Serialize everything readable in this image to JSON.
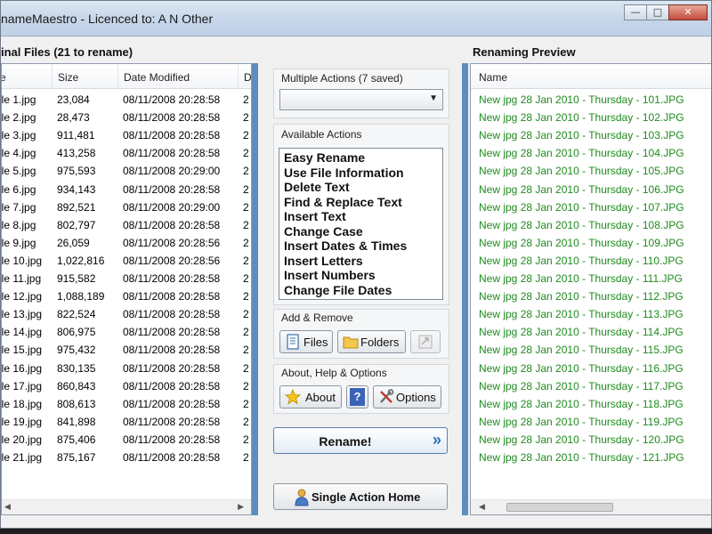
{
  "window": {
    "title": "nameMaestro - Licenced to: A N Other",
    "controls": [
      "—",
      "□",
      "✕"
    ]
  },
  "original_files": {
    "title": "inal Files (21 to rename)",
    "columns": {
      "name": "e",
      "size": "Size",
      "date": "Date Modified",
      "extra": "D"
    },
    "rows": [
      {
        "name": "ile 1.jpg",
        "size": "23,084",
        "date": "08/11/2008 20:28:58",
        "extra": "2"
      },
      {
        "name": "ile 2.jpg",
        "size": "28,473",
        "date": "08/11/2008 20:28:58",
        "extra": "2"
      },
      {
        "name": "ile 3.jpg",
        "size": "911,481",
        "date": "08/11/2008 20:28:58",
        "extra": "2"
      },
      {
        "name": "ile 4.jpg",
        "size": "413,258",
        "date": "08/11/2008 20:28:58",
        "extra": "2"
      },
      {
        "name": "ile 5.jpg",
        "size": "975,593",
        "date": "08/11/2008 20:29:00",
        "extra": "2"
      },
      {
        "name": "ile 6.jpg",
        "size": "934,143",
        "date": "08/11/2008 20:28:58",
        "extra": "2"
      },
      {
        "name": "ile 7.jpg",
        "size": "892,521",
        "date": "08/11/2008 20:29:00",
        "extra": "2"
      },
      {
        "name": "ile 8.jpg",
        "size": "802,797",
        "date": "08/11/2008 20:28:58",
        "extra": "2"
      },
      {
        "name": "ile 9.jpg",
        "size": "26,059",
        "date": "08/11/2008 20:28:56",
        "extra": "2"
      },
      {
        "name": "ile 10.jpg",
        "size": "1,022,816",
        "date": "08/11/2008 20:28:56",
        "extra": "2"
      },
      {
        "name": "ile 11.jpg",
        "size": "915,582",
        "date": "08/11/2008 20:28:58",
        "extra": "2"
      },
      {
        "name": "ile 12.jpg",
        "size": "1,088,189",
        "date": "08/11/2008 20:28:58",
        "extra": "2"
      },
      {
        "name": "ile 13.jpg",
        "size": "822,524",
        "date": "08/11/2008 20:28:58",
        "extra": "2"
      },
      {
        "name": "ile 14.jpg",
        "size": "806,975",
        "date": "08/11/2008 20:28:58",
        "extra": "2"
      },
      {
        "name": "ile 15.jpg",
        "size": "975,432",
        "date": "08/11/2008 20:28:58",
        "extra": "2"
      },
      {
        "name": "ile 16.jpg",
        "size": "830,135",
        "date": "08/11/2008 20:28:58",
        "extra": "2"
      },
      {
        "name": "ile 17.jpg",
        "size": "860,843",
        "date": "08/11/2008 20:28:58",
        "extra": "2"
      },
      {
        "name": "ile 18.jpg",
        "size": "808,613",
        "date": "08/11/2008 20:28:58",
        "extra": "2"
      },
      {
        "name": "ile 19.jpg",
        "size": "841,898",
        "date": "08/11/2008 20:28:58",
        "extra": "2"
      },
      {
        "name": "ile 20.jpg",
        "size": "875,406",
        "date": "08/11/2008 20:28:58",
        "extra": "2"
      },
      {
        "name": "ile 21.jpg",
        "size": "875,167",
        "date": "08/11/2008 20:28:58",
        "extra": "2"
      }
    ]
  },
  "multiple_actions": {
    "label": "Multiple Actions (7 saved)",
    "selected": ""
  },
  "available_actions": {
    "label": "Available Actions",
    "items": [
      "Easy Rename",
      "Use File Information",
      "Delete Text",
      "Find & Replace Text",
      "Insert Text",
      "Change Case",
      "Insert Dates & Times",
      "Insert Letters",
      "Insert Numbers",
      "Change File Dates"
    ]
  },
  "add_remove": {
    "label": "Add & Remove",
    "files": "Files",
    "folders": "Folders"
  },
  "about_help": {
    "label": "About, Help & Options",
    "about": "About",
    "help": "?",
    "options": "Options"
  },
  "rename_button": "Rename!",
  "single_action_home": "Single Action Home",
  "preview": {
    "title": "Renaming Preview",
    "column": "Name",
    "rows": [
      "New jpg 28 Jan 2010 - Thursday - 101.JPG",
      "New jpg 28 Jan 2010 - Thursday - 102.JPG",
      "New jpg 28 Jan 2010 - Thursday - 103.JPG",
      "New jpg 28 Jan 2010 - Thursday - 104.JPG",
      "New jpg 28 Jan 2010 - Thursday - 105.JPG",
      "New jpg 28 Jan 2010 - Thursday - 106.JPG",
      "New jpg 28 Jan 2010 - Thursday - 107.JPG",
      "New jpg 28 Jan 2010 - Thursday - 108.JPG",
      "New jpg 28 Jan 2010 - Thursday - 109.JPG",
      "New jpg 28 Jan 2010 - Thursday - 110.JPG",
      "New jpg 28 Jan 2010 - Thursday - 111.JPG",
      "New jpg 28 Jan 2010 - Thursday - 112.JPG",
      "New jpg 28 Jan 2010 - Thursday - 113.JPG",
      "New jpg 28 Jan 2010 - Thursday - 114.JPG",
      "New jpg 28 Jan 2010 - Thursday - 115.JPG",
      "New jpg 28 Jan 2010 - Thursday - 116.JPG",
      "New jpg 28 Jan 2010 - Thursday - 117.JPG",
      "New jpg 28 Jan 2010 - Thursday - 118.JPG",
      "New jpg 28 Jan 2010 - Thursday - 119.JPG",
      "New jpg 28 Jan 2010 - Thursday - 120.JPG",
      "New jpg 28 Jan 2010 - Thursday - 121.JPG"
    ]
  },
  "icons": {
    "files_button": "document-icon",
    "folders_button": "folder-icon",
    "remove_button": "remove-icon",
    "about_button": "star-icon",
    "help_button": "help-icon",
    "options_button": "tools-icon",
    "rename_button": "double-chevron-right-icon",
    "home_button": "user-icon"
  },
  "colors": {
    "preview_text": "#1f8a1f",
    "splitter": "#5d8dc0",
    "accent": "#2f6cb5"
  }
}
